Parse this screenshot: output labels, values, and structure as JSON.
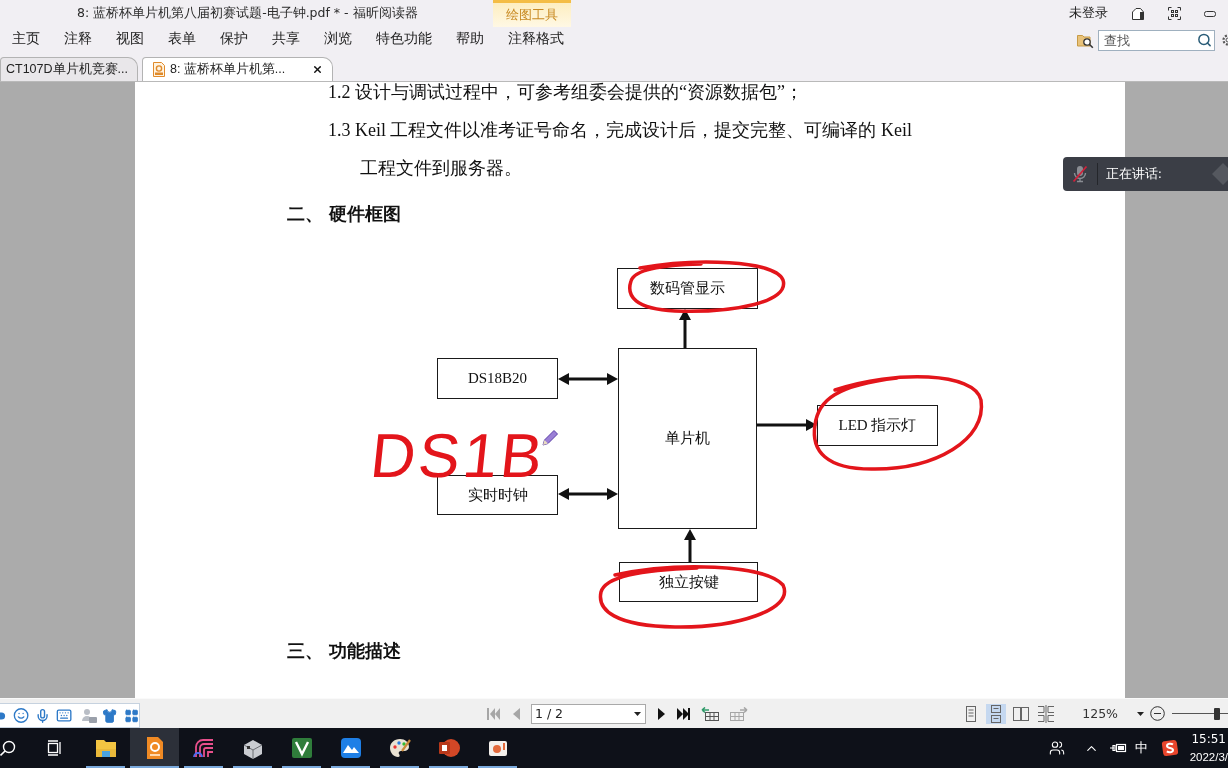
{
  "window": {
    "title": "8: 蓝桥杯单片机第八届初赛试题-电子钟.pdf * - 福昕阅读器",
    "context_tab": "绘图工具",
    "account": "未登录"
  },
  "menu": [
    {
      "label": "主页",
      "selected": false
    },
    {
      "label": "注释",
      "selected": false
    },
    {
      "label": "视图",
      "selected": false
    },
    {
      "label": "表单",
      "selected": false
    },
    {
      "label": "保护",
      "selected": false
    },
    {
      "label": "共享",
      "selected": false
    },
    {
      "label": "浏览",
      "selected": false
    },
    {
      "label": "特色功能",
      "selected": false
    },
    {
      "label": "帮助",
      "selected": false
    },
    {
      "label": "注释格式",
      "selected": false
    }
  ],
  "search": {
    "placeholder": "查找"
  },
  "doc_tabs": [
    {
      "label": "CT107D单片机竞赛...",
      "selected": false
    },
    {
      "label": "8: 蓝桥杯单片机第...",
      "selected": true
    }
  ],
  "document": {
    "lines": [
      {
        "kind": "item",
        "text": "1.2 设计与调试过程中，可参考组委会提供的“资源数据包”；"
      },
      {
        "kind": "item",
        "text": "1.3 Keil 工程文件以准考证号命名，完成设计后，提交完整、可编译的 Keil"
      },
      {
        "kind": "continuation",
        "text": "工程文件到服务器。"
      }
    ],
    "section_heading": "二、 硬件框图",
    "diagram": {
      "top": {
        "label": "数码管显示",
        "circled": true,
        "head_at_block": true,
        "head_at_mcu": false
      },
      "left": [
        {
          "label": "DS18B20",
          "circled": false,
          "head_at_block": true,
          "head_at_mcu": true
        },
        {
          "label": "实时时钟",
          "circled": false,
          "head_at_block": true,
          "head_at_mcu": true
        }
      ],
      "center": {
        "label": "单片机"
      },
      "right": {
        "label": "LED 指示灯",
        "circled": true,
        "head_at_block": true,
        "head_at_mcu": false
      },
      "bottom": {
        "label": "独立按键",
        "circled": true,
        "head_at_block": false,
        "head_at_mcu": true
      },
      "ink_note": "DS1B"
    },
    "next_section_heading": "三、 功能描述"
  },
  "speaking_panel": {
    "label": "正在讲话:",
    "mic_muted": true
  },
  "status_bar": {
    "page_nav": [
      {
        "kind": "first",
        "disabled": true
      },
      {
        "kind": "previous",
        "disabled": true
      },
      {
        "kind": "next",
        "disabled": false
      },
      {
        "kind": "last",
        "disabled": false
      },
      {
        "kind": "back-view",
        "disabled": false
      },
      {
        "kind": "forward-view",
        "disabled": true
      }
    ],
    "page": "1 / 2",
    "view_modes": [
      {
        "kind": "single",
        "selected": false
      },
      {
        "kind": "continuous",
        "selected": true
      },
      {
        "kind": "facing",
        "selected": false
      },
      {
        "kind": "continuous-facing",
        "selected": false
      }
    ],
    "zoom": "125%",
    "zoom_slider": {
      "level": 0.8
    }
  },
  "taskbar": {
    "apps": [
      {
        "kind": "folder",
        "selected": false
      },
      {
        "kind": "pdf",
        "selected": true
      },
      {
        "kind": "arcs",
        "selected": false
      },
      {
        "kind": "box",
        "selected": false
      },
      {
        "kind": "chevron",
        "selected": false
      },
      {
        "kind": "mountain",
        "selected": false
      },
      {
        "kind": "palette",
        "selected": false
      },
      {
        "kind": "slides",
        "selected": false
      },
      {
        "kind": "photo",
        "selected": false
      }
    ],
    "ime_mode": "中",
    "clock": {
      "time": "15:51",
      "date": "2022/3/"
    }
  }
}
